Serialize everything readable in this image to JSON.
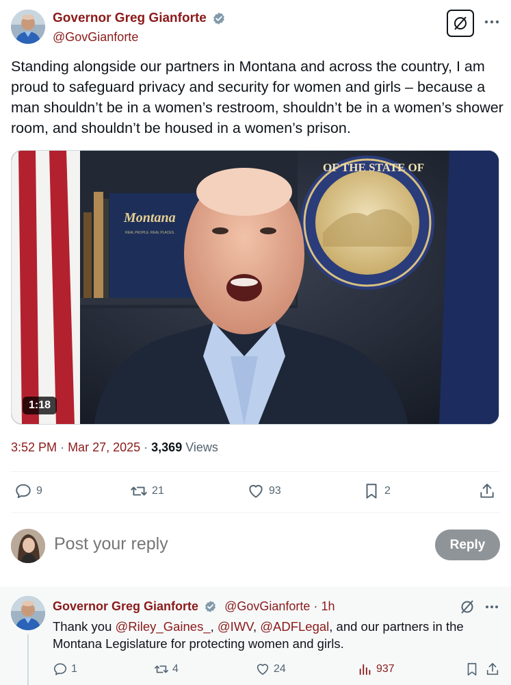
{
  "post": {
    "author_name": "Governor Greg Gianforte",
    "author_handle": "@GovGianforte",
    "text": "Standing alongside our partners in Montana and across the country, I am proud to safeguard privacy and security for women and girls – because a man shouldn’t be in a women’s restroom, shouldn’t be in a women’s shower room, and shouldn’t be housed in a women’s prison.",
    "video_duration": "1:18",
    "book_spine_text": "Montana",
    "book_sub_text": "REAL PEOPLE. REAL PLACES.",
    "seal_text": "OF THE STATE OF",
    "time": "3:52 PM",
    "date": "Mar 27, 2025",
    "views_count": "3,369",
    "views_label": "Views"
  },
  "actions": {
    "replies": "9",
    "reposts": "21",
    "likes": "93",
    "bookmarks": "2"
  },
  "reply_composer": {
    "placeholder": "Post your reply",
    "button_label": "Reply"
  },
  "thread_reply": {
    "author_name": "Governor Greg Gianforte",
    "author_handle": "@GovGianforte",
    "separator": "·",
    "time_ago": "1h",
    "text_prefix": "Thank you ",
    "mention_1": "@Riley_Gaines_",
    "sep_1": ", ",
    "mention_2": "@IWV",
    "sep_2": ", ",
    "mention_3": "@ADFLegal",
    "text_suffix": ", and our partners in the Montana Legislature for protecting women and girls.",
    "replies": "1",
    "reposts": "4",
    "likes": "24",
    "views": "937"
  },
  "colors": {
    "accent": "#8b1a1a",
    "muted": "#536471",
    "reply_button": "#8f9498",
    "verified": "#829aab"
  }
}
